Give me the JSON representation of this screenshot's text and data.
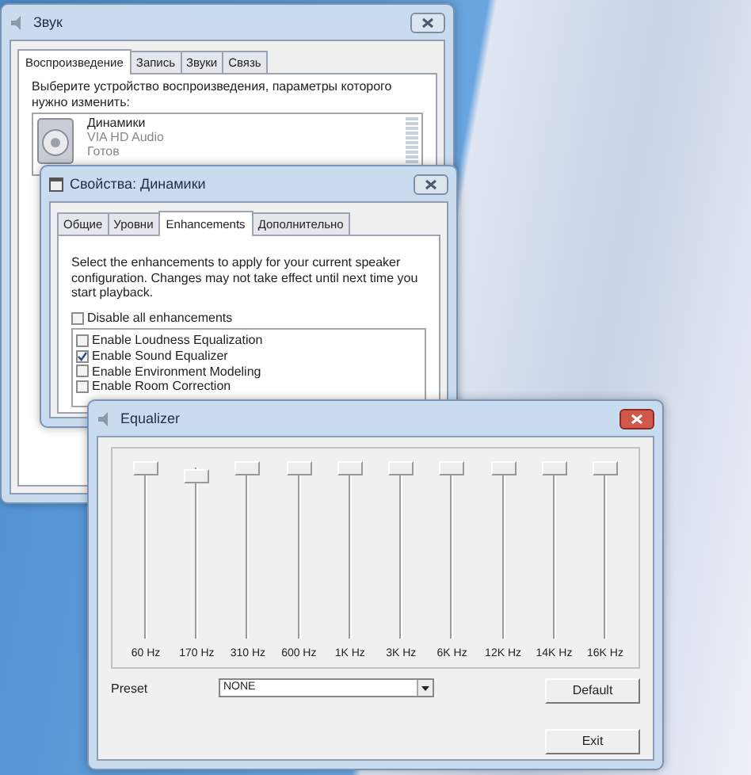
{
  "sound_window": {
    "title": "Звук",
    "tabs": [
      {
        "label": "Воспроизведение",
        "selected": true
      },
      {
        "label": "Запись",
        "selected": false
      },
      {
        "label": "Звуки",
        "selected": false
      },
      {
        "label": "Связь",
        "selected": false
      }
    ],
    "instruction": "Выберите устройство воспроизведения, параметры которого нужно изменить:",
    "device": {
      "name": "Динамики",
      "driver": "VIA HD Audio",
      "status": "Готов"
    }
  },
  "properties_window": {
    "title": "Свойства: Динамики",
    "tabs": [
      {
        "label": "Общие",
        "selected": false
      },
      {
        "label": "Уровни",
        "selected": false
      },
      {
        "label": "Enhancements",
        "selected": true
      },
      {
        "label": "Дополнительно",
        "selected": false
      }
    ],
    "description": "Select the enhancements to apply for your current speaker configuration. Changes may not take effect until next time you start playback.",
    "disable_all": {
      "label": "Disable all enhancements",
      "checked": false
    },
    "enhancements": [
      {
        "label": "Enable Loudness Equalization",
        "checked": false
      },
      {
        "label": "Enable Sound Equalizer",
        "checked": true
      },
      {
        "label": "Enable Environment Modeling",
        "checked": false
      },
      {
        "label": "Enable Room Correction",
        "checked": false
      }
    ]
  },
  "equalizer_window": {
    "title": "Equalizer",
    "bands": [
      {
        "label": "60 Hz",
        "level": 1
      },
      {
        "label": "170 Hz",
        "level": 0.95
      },
      {
        "label": "310 Hz",
        "level": 1
      },
      {
        "label": "600 Hz",
        "level": 1
      },
      {
        "label": "1K Hz",
        "level": 1
      },
      {
        "label": "3K Hz",
        "level": 1
      },
      {
        "label": "6K Hz",
        "level": 1
      },
      {
        "label": "12K Hz",
        "level": 1
      },
      {
        "label": "14K Hz",
        "level": 1
      },
      {
        "label": "16K Hz",
        "level": 1
      }
    ],
    "preset": {
      "label": "Preset",
      "value": "NONE"
    },
    "buttons": [
      {
        "label": "Default"
      },
      {
        "label": "Exit"
      }
    ]
  }
}
